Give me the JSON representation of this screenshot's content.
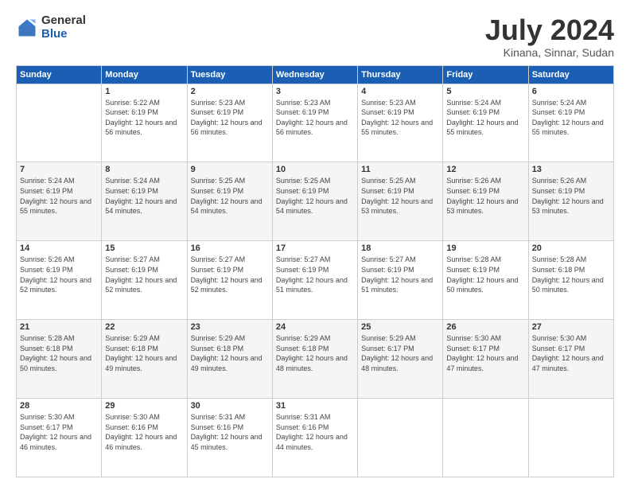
{
  "logo": {
    "general": "General",
    "blue": "Blue"
  },
  "header": {
    "title": "July 2024",
    "subtitle": "Kinana, Sinnar, Sudan"
  },
  "weekdays": [
    "Sunday",
    "Monday",
    "Tuesday",
    "Wednesday",
    "Thursday",
    "Friday",
    "Saturday"
  ],
  "weeks": [
    [
      {
        "day": "",
        "sunrise": "",
        "sunset": "",
        "daylight": ""
      },
      {
        "day": "1",
        "sunrise": "Sunrise: 5:22 AM",
        "sunset": "Sunset: 6:19 PM",
        "daylight": "Daylight: 12 hours and 56 minutes."
      },
      {
        "day": "2",
        "sunrise": "Sunrise: 5:23 AM",
        "sunset": "Sunset: 6:19 PM",
        "daylight": "Daylight: 12 hours and 56 minutes."
      },
      {
        "day": "3",
        "sunrise": "Sunrise: 5:23 AM",
        "sunset": "Sunset: 6:19 PM",
        "daylight": "Daylight: 12 hours and 56 minutes."
      },
      {
        "day": "4",
        "sunrise": "Sunrise: 5:23 AM",
        "sunset": "Sunset: 6:19 PM",
        "daylight": "Daylight: 12 hours and 55 minutes."
      },
      {
        "day": "5",
        "sunrise": "Sunrise: 5:24 AM",
        "sunset": "Sunset: 6:19 PM",
        "daylight": "Daylight: 12 hours and 55 minutes."
      },
      {
        "day": "6",
        "sunrise": "Sunrise: 5:24 AM",
        "sunset": "Sunset: 6:19 PM",
        "daylight": "Daylight: 12 hours and 55 minutes."
      }
    ],
    [
      {
        "day": "7",
        "sunrise": "Sunrise: 5:24 AM",
        "sunset": "Sunset: 6:19 PM",
        "daylight": "Daylight: 12 hours and 55 minutes."
      },
      {
        "day": "8",
        "sunrise": "Sunrise: 5:24 AM",
        "sunset": "Sunset: 6:19 PM",
        "daylight": "Daylight: 12 hours and 54 minutes."
      },
      {
        "day": "9",
        "sunrise": "Sunrise: 5:25 AM",
        "sunset": "Sunset: 6:19 PM",
        "daylight": "Daylight: 12 hours and 54 minutes."
      },
      {
        "day": "10",
        "sunrise": "Sunrise: 5:25 AM",
        "sunset": "Sunset: 6:19 PM",
        "daylight": "Daylight: 12 hours and 54 minutes."
      },
      {
        "day": "11",
        "sunrise": "Sunrise: 5:25 AM",
        "sunset": "Sunset: 6:19 PM",
        "daylight": "Daylight: 12 hours and 53 minutes."
      },
      {
        "day": "12",
        "sunrise": "Sunrise: 5:26 AM",
        "sunset": "Sunset: 6:19 PM",
        "daylight": "Daylight: 12 hours and 53 minutes."
      },
      {
        "day": "13",
        "sunrise": "Sunrise: 5:26 AM",
        "sunset": "Sunset: 6:19 PM",
        "daylight": "Daylight: 12 hours and 53 minutes."
      }
    ],
    [
      {
        "day": "14",
        "sunrise": "Sunrise: 5:26 AM",
        "sunset": "Sunset: 6:19 PM",
        "daylight": "Daylight: 12 hours and 52 minutes."
      },
      {
        "day": "15",
        "sunrise": "Sunrise: 5:27 AM",
        "sunset": "Sunset: 6:19 PM",
        "daylight": "Daylight: 12 hours and 52 minutes."
      },
      {
        "day": "16",
        "sunrise": "Sunrise: 5:27 AM",
        "sunset": "Sunset: 6:19 PM",
        "daylight": "Daylight: 12 hours and 52 minutes."
      },
      {
        "day": "17",
        "sunrise": "Sunrise: 5:27 AM",
        "sunset": "Sunset: 6:19 PM",
        "daylight": "Daylight: 12 hours and 51 minutes."
      },
      {
        "day": "18",
        "sunrise": "Sunrise: 5:27 AM",
        "sunset": "Sunset: 6:19 PM",
        "daylight": "Daylight: 12 hours and 51 minutes."
      },
      {
        "day": "19",
        "sunrise": "Sunrise: 5:28 AM",
        "sunset": "Sunset: 6:19 PM",
        "daylight": "Daylight: 12 hours and 50 minutes."
      },
      {
        "day": "20",
        "sunrise": "Sunrise: 5:28 AM",
        "sunset": "Sunset: 6:18 PM",
        "daylight": "Daylight: 12 hours and 50 minutes."
      }
    ],
    [
      {
        "day": "21",
        "sunrise": "Sunrise: 5:28 AM",
        "sunset": "Sunset: 6:18 PM",
        "daylight": "Daylight: 12 hours and 50 minutes."
      },
      {
        "day": "22",
        "sunrise": "Sunrise: 5:29 AM",
        "sunset": "Sunset: 6:18 PM",
        "daylight": "Daylight: 12 hours and 49 minutes."
      },
      {
        "day": "23",
        "sunrise": "Sunrise: 5:29 AM",
        "sunset": "Sunset: 6:18 PM",
        "daylight": "Daylight: 12 hours and 49 minutes."
      },
      {
        "day": "24",
        "sunrise": "Sunrise: 5:29 AM",
        "sunset": "Sunset: 6:18 PM",
        "daylight": "Daylight: 12 hours and 48 minutes."
      },
      {
        "day": "25",
        "sunrise": "Sunrise: 5:29 AM",
        "sunset": "Sunset: 6:17 PM",
        "daylight": "Daylight: 12 hours and 48 minutes."
      },
      {
        "day": "26",
        "sunrise": "Sunrise: 5:30 AM",
        "sunset": "Sunset: 6:17 PM",
        "daylight": "Daylight: 12 hours and 47 minutes."
      },
      {
        "day": "27",
        "sunrise": "Sunrise: 5:30 AM",
        "sunset": "Sunset: 6:17 PM",
        "daylight": "Daylight: 12 hours and 47 minutes."
      }
    ],
    [
      {
        "day": "28",
        "sunrise": "Sunrise: 5:30 AM",
        "sunset": "Sunset: 6:17 PM",
        "daylight": "Daylight: 12 hours and 46 minutes."
      },
      {
        "day": "29",
        "sunrise": "Sunrise: 5:30 AM",
        "sunset": "Sunset: 6:16 PM",
        "daylight": "Daylight: 12 hours and 46 minutes."
      },
      {
        "day": "30",
        "sunrise": "Sunrise: 5:31 AM",
        "sunset": "Sunset: 6:16 PM",
        "daylight": "Daylight: 12 hours and 45 minutes."
      },
      {
        "day": "31",
        "sunrise": "Sunrise: 5:31 AM",
        "sunset": "Sunset: 6:16 PM",
        "daylight": "Daylight: 12 hours and 44 minutes."
      },
      {
        "day": "",
        "sunrise": "",
        "sunset": "",
        "daylight": ""
      },
      {
        "day": "",
        "sunrise": "",
        "sunset": "",
        "daylight": ""
      },
      {
        "day": "",
        "sunrise": "",
        "sunset": "",
        "daylight": ""
      }
    ]
  ]
}
